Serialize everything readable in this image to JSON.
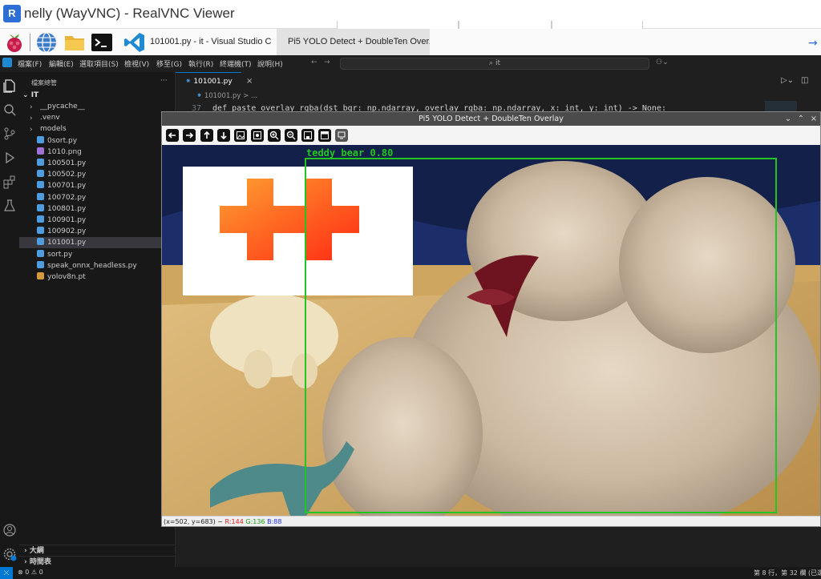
{
  "vnc": {
    "title": "nelly (WayVNC) - RealVNC Viewer",
    "logo_text": "R"
  },
  "taskbar": {
    "tasks": [
      {
        "label": "101001.py - it - Visual Studio C.."
      },
      {
        "label": "Pi5 YOLO Detect + DoubleTen Over.."
      }
    ]
  },
  "vscode": {
    "menu": [
      "檔案(F)",
      "編輯(E)",
      "選取項目(S)",
      "檢視(V)",
      "移至(G)",
      "執行(R)",
      "終端機(T)",
      "說明(H)"
    ],
    "search_placeholder": "it",
    "explorer_title": "檔案總管",
    "explorer_more": "···",
    "root_folder": "IT",
    "tree": [
      {
        "label": "__pycache__",
        "kind": "folder"
      },
      {
        "label": ".venv",
        "kind": "folder"
      },
      {
        "label": "models",
        "kind": "folder"
      },
      {
        "label": "0sort.py",
        "kind": "py"
      },
      {
        "label": "1010.png",
        "kind": "png"
      },
      {
        "label": "100501.py",
        "kind": "py"
      },
      {
        "label": "100502.py",
        "kind": "py"
      },
      {
        "label": "100701.py",
        "kind": "py"
      },
      {
        "label": "100702.py",
        "kind": "py"
      },
      {
        "label": "100801.py",
        "kind": "py"
      },
      {
        "label": "100901.py",
        "kind": "py"
      },
      {
        "label": "100902.py",
        "kind": "py"
      },
      {
        "label": "101001.py",
        "kind": "py",
        "selected": true
      },
      {
        "label": "sort.py",
        "kind": "py"
      },
      {
        "label": "speak_onnx_headless.py",
        "kind": "py"
      },
      {
        "label": "yolov8n.pt",
        "kind": "pt"
      }
    ],
    "outline_label": "大綱",
    "timeline_label": "時間表",
    "tab_label": "101001.py",
    "breadcrumb": "101001.py > ...",
    "code_line_no": "37",
    "code_text": "def paste_overlay_rgba(dst_bgr: np.ndarray, overlay_rgba: np.ndarray, x: int, y: int) -> None:",
    "status_problems": "⊗ 0 ⚠ 0",
    "status_position": "第 8 行，第 32 欄 (已選"
  },
  "yolo": {
    "title": "Pi5 YOLO Detect + DoubleTen Overlay",
    "detection_label": "teddy bear 0.80",
    "status_coords": "(x=502, y=683) ~",
    "status_r": "R:144",
    "status_g": "G:136",
    "status_b": "B:88",
    "box_color": "#22c522"
  },
  "colors": {
    "vsc_accent": "#0078d4",
    "overlay_start": "#ffa030",
    "overlay_end": "#ff2a14"
  },
  "icons": [
    "raspberry-icon",
    "globe-icon",
    "folder-icon",
    "terminal-icon",
    "vscode-icon"
  ]
}
